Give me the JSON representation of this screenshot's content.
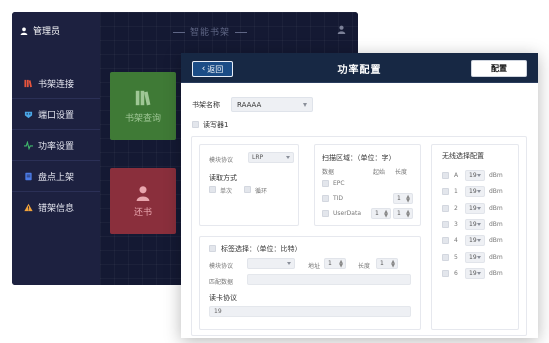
{
  "sidebar": {
    "user_label": "管理员",
    "items": [
      {
        "label": "书架连接",
        "icon": "bookshelf-icon",
        "color": "#e8553d"
      },
      {
        "label": "端口设置",
        "icon": "port-icon",
        "color": "#4aa8e8"
      },
      {
        "label": "功率设置",
        "icon": "pulse-icon",
        "color": "#3fb86b"
      },
      {
        "label": "盘点上架",
        "icon": "inventory-icon",
        "color": "#4b7be6"
      },
      {
        "label": "错架信息",
        "icon": "warning-icon",
        "color": "#f2a33a"
      }
    ]
  },
  "main": {
    "title": "智能书架",
    "tiles": [
      {
        "label": "书架查询",
        "icon": "books-icon"
      },
      {
        "label": "还书",
        "icon": "return-icon"
      }
    ]
  },
  "dialog": {
    "back_label": "返回",
    "title": "功率配置",
    "config_label": "配置",
    "shelf_label": "书架名称",
    "shelf_value": "RAAAA",
    "reader_label": "读写器1",
    "protocol_label": "模块协议",
    "protocol_value": "LRP",
    "read_mode_label": "读取方式",
    "read_mode_single": "单次",
    "read_mode_loop": "循环",
    "scan_area_label": "扫描区域：（单位：字）",
    "scan_headers": {
      "data": "数据",
      "start": "起始",
      "length": "长度"
    },
    "scan_rows": [
      {
        "name": "EPC",
        "start": "",
        "length": ""
      },
      {
        "name": "TID",
        "start": "",
        "length": "1"
      },
      {
        "name": "UserData",
        "start": "1",
        "length": "1"
      }
    ],
    "tag_select_label": "标签选择：（单位：比特）",
    "tag_protocol_label": "模块协议",
    "tag_protocol_value": "",
    "address_label": "地址",
    "address_value": "1",
    "length_label": "长度",
    "length_value": "1",
    "match_data_label": "匹配数据",
    "match_data_value": "",
    "card_protocol_label": "读卡协议",
    "card_protocol_value": "19",
    "wireless_label": "无线选择配置",
    "unit": "dBm",
    "antennas": [
      {
        "name": "A",
        "value": "19"
      },
      {
        "name": "1",
        "value": "19"
      },
      {
        "name": "2",
        "value": "19"
      },
      {
        "name": "3",
        "value": "19"
      },
      {
        "name": "4",
        "value": "19"
      },
      {
        "name": "5",
        "value": "19"
      },
      {
        "name": "6",
        "value": "19"
      }
    ]
  }
}
